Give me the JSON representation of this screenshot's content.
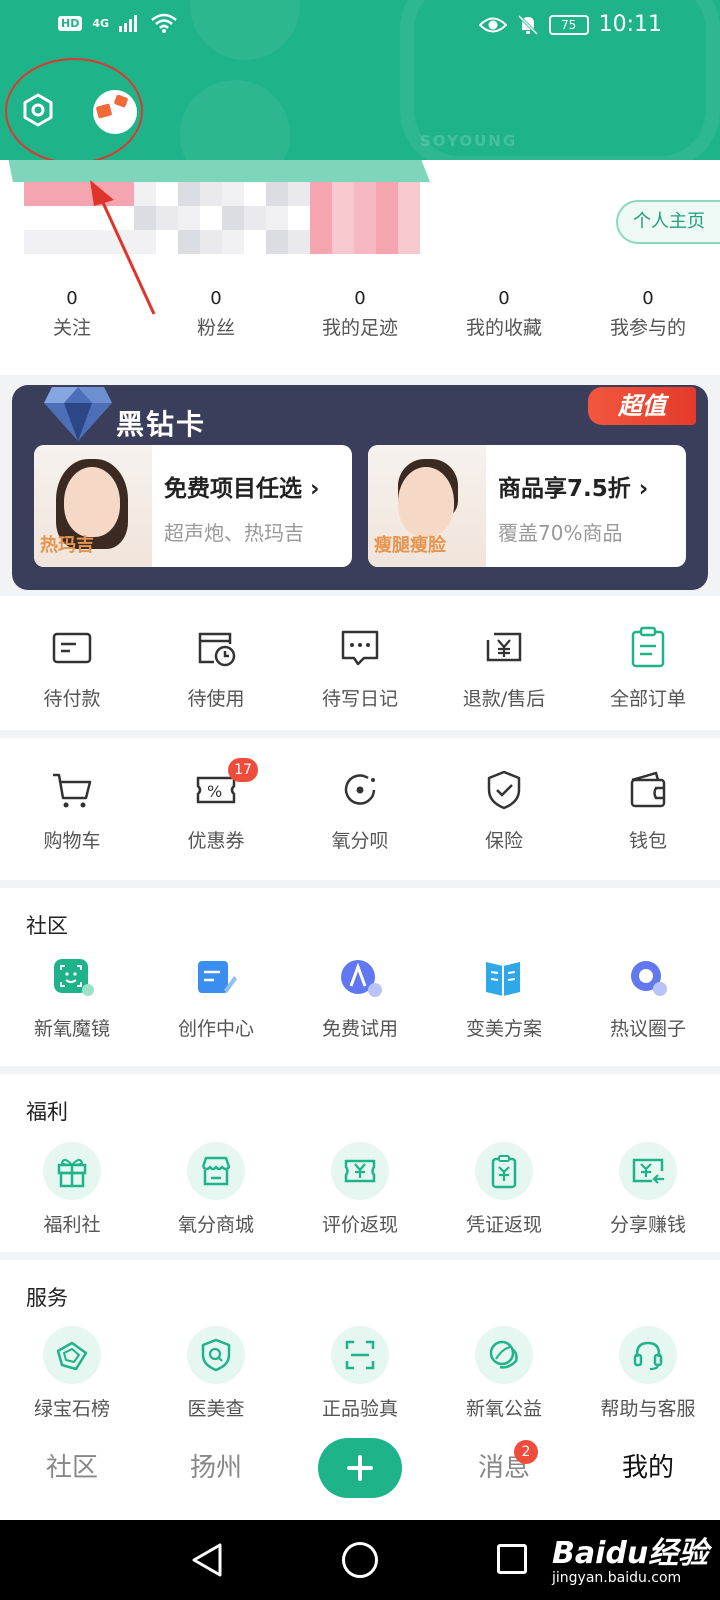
{
  "status_bar": {
    "hd": "HD",
    "network": "4G",
    "battery": "75",
    "time": "10:11"
  },
  "header": {
    "brand_watermark": "SOYOUNG"
  },
  "profile": {
    "home_button": "个人主页"
  },
  "stats": [
    {
      "num": "0",
      "label": "关注"
    },
    {
      "num": "0",
      "label": "粉丝"
    },
    {
      "num": "0",
      "label": "我的足迹"
    },
    {
      "num": "0",
      "label": "我的收藏"
    },
    {
      "num": "0",
      "label": "我参与的"
    }
  ],
  "vip_card": {
    "title": "黑钻卡",
    "badge": "超值",
    "items": [
      {
        "name": "免费项目任选 ›",
        "sub": "超声炮、热玛吉",
        "photo_tag": "热玛吉"
      },
      {
        "name": "商品享7.5折 ›",
        "sub": "覆盖70%商品",
        "photo_tag": "瘦腿瘦脸"
      }
    ]
  },
  "orders": [
    {
      "label": "待付款",
      "icon": "card-icon"
    },
    {
      "label": "待使用",
      "icon": "clock-icon"
    },
    {
      "label": "待写日记",
      "icon": "message-icon"
    },
    {
      "label": "退款/售后",
      "icon": "refund-icon"
    },
    {
      "label": "全部订单",
      "icon": "clipboard-icon"
    }
  ],
  "tools": [
    {
      "label": "购物车",
      "icon": "cart-icon"
    },
    {
      "label": "优惠券",
      "icon": "coupon-icon",
      "badge": "17"
    },
    {
      "label": "氧分呗",
      "icon": "oxygen-icon"
    },
    {
      "label": "保险",
      "icon": "shield-icon"
    },
    {
      "label": "钱包",
      "icon": "wallet-icon"
    }
  ],
  "community": {
    "title": "社区",
    "items": [
      {
        "label": "新氧魔镜",
        "icon": "face-scan-icon"
      },
      {
        "label": "创作中心",
        "icon": "document-edit-icon"
      },
      {
        "label": "免费试用",
        "icon": "trial-icon"
      },
      {
        "label": "变美方案",
        "icon": "book-icon"
      },
      {
        "label": "热议圈子",
        "icon": "circle-icon"
      }
    ]
  },
  "welfare": {
    "title": "福利",
    "items": [
      {
        "label": "福利社",
        "icon": "gift-icon"
      },
      {
        "label": "氧分商城",
        "icon": "store-icon"
      },
      {
        "label": "评价返现",
        "icon": "ticket-yen-icon"
      },
      {
        "label": "凭证返现",
        "icon": "receipt-yen-icon"
      },
      {
        "label": "分享赚钱",
        "icon": "share-money-icon"
      }
    ]
  },
  "services": {
    "title": "服务",
    "items": [
      {
        "label": "绿宝石榜",
        "icon": "gem-icon"
      },
      {
        "label": "医美查",
        "icon": "search-shield-icon"
      },
      {
        "label": "正品验真",
        "icon": "scan-icon"
      },
      {
        "label": "新氧公益",
        "icon": "charity-icon"
      },
      {
        "label": "帮助与客服",
        "icon": "headset-icon"
      }
    ]
  },
  "tabbar": [
    {
      "label": "社区"
    },
    {
      "label": "扬州"
    },
    {
      "label": ""
    },
    {
      "label": "消息",
      "badge": "2"
    },
    {
      "label": "我的"
    }
  ],
  "watermark": {
    "line1": "Baidu经验",
    "line2": "jingyan.baidu.com"
  },
  "colors": {
    "brand": "#1fb389",
    "badge": "#ef4c3c",
    "vip_bg": "#3b3e5a"
  }
}
